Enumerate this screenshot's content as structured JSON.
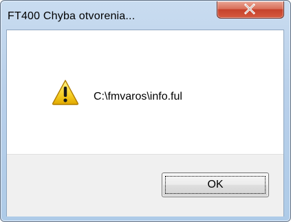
{
  "window": {
    "title": "FT400 Chyba otvorenia..."
  },
  "dialog": {
    "message": "C:\\fmvaros\\info.ful",
    "icon": "warning-icon",
    "ok_label": "OK"
  },
  "colors": {
    "titlebar": "#b9d0ea",
    "close_button": "#c6422b",
    "footer": "#f0f0f0"
  }
}
